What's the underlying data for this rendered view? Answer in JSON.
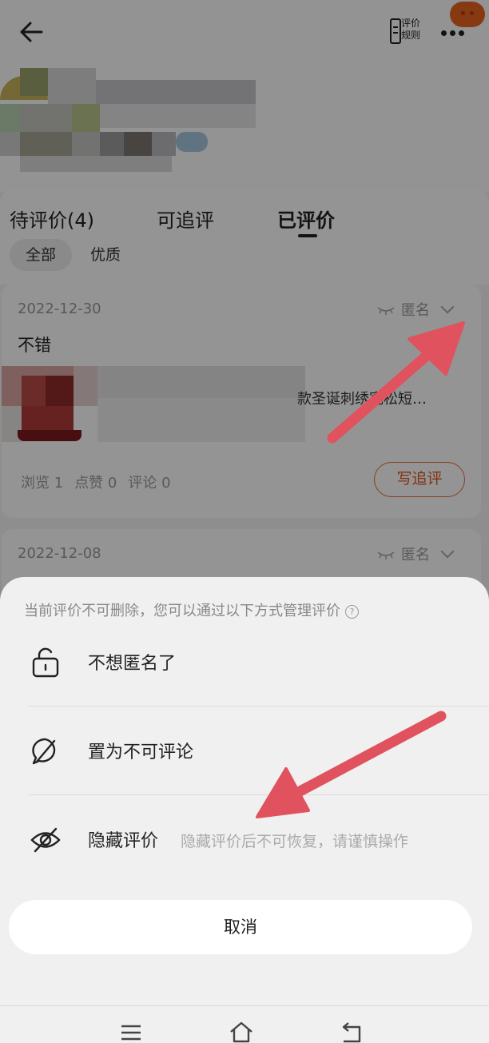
{
  "header": {
    "rules_label": "评价规则",
    "rules_line1": "评价",
    "rules_line2": "规则"
  },
  "tabs": [
    {
      "label": "待评价(4)"
    },
    {
      "label": "可追评"
    },
    {
      "label": "已评价"
    }
  ],
  "filters": [
    {
      "label": "全部",
      "selected": true
    },
    {
      "label": "优质",
      "selected": false
    }
  ],
  "reviews": [
    {
      "date": "2022-12-30",
      "anonymous_label": "匿名",
      "text": "不错",
      "product_title": "款圣诞刺绣宽松短…",
      "stats": {
        "views": "浏览 1",
        "likes": "点赞 0",
        "comments": "评论 0"
      },
      "follow_up_label": "写追评"
    },
    {
      "date": "2022-12-08",
      "anonymous_label": "匿名"
    }
  ],
  "sheet": {
    "hint": "当前评价不可删除，您可以通过以下方式管理评价",
    "options": [
      {
        "label": "不想匿名了",
        "icon": "unlock-icon"
      },
      {
        "label": "置为不可评论",
        "icon": "comment-disabled-icon"
      },
      {
        "label": "隐藏评价",
        "icon": "eye-hidden-icon",
        "desc": "隐藏评价后不可恢复，请谨慎操作"
      }
    ],
    "cancel_label": "取消"
  },
  "colors": {
    "accent": "#e1541f",
    "annotation_arrow": "#e0525d"
  }
}
